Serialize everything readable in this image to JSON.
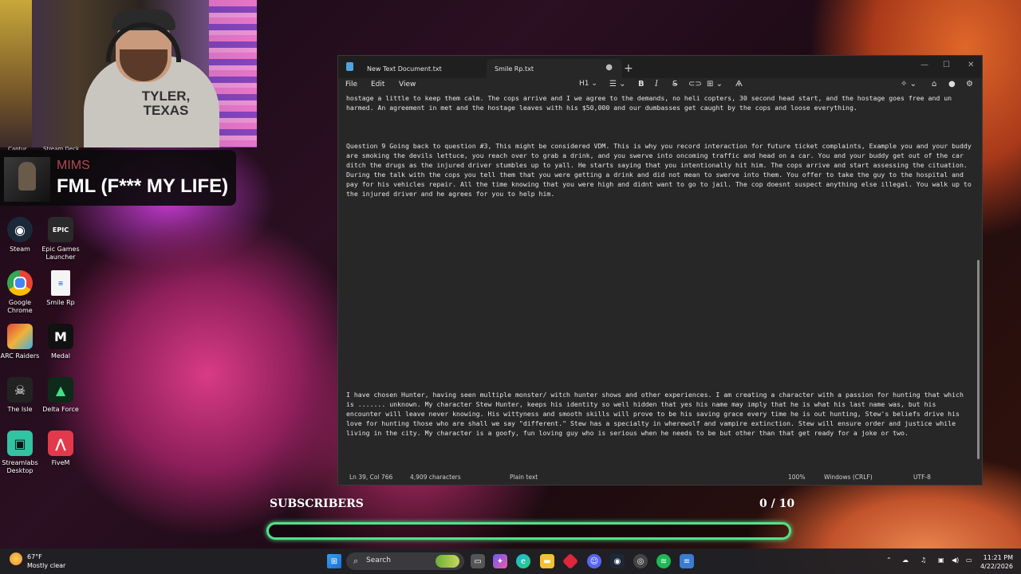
{
  "webcam": {
    "shirt_text": "TYLER, TEXAS",
    "captions": [
      "Captur",
      "Stream Deck"
    ]
  },
  "now_playing": {
    "artist": "MIMS",
    "title": "FML (F*** MY LIFE)"
  },
  "desktop_icons": [
    {
      "label": "Steam",
      "icon": "steam-icon",
      "color": "#1b2838"
    },
    {
      "label": "Epic Games Launcher",
      "icon": "epic-games-icon",
      "color": "#2a2a2a"
    },
    {
      "label": "Google Chrome",
      "icon": "chrome-icon",
      "color": "#ffffff"
    },
    {
      "label": "Smile Rp",
      "icon": "text-file-icon",
      "color": "#ffffff"
    },
    {
      "label": "ARC Raiders",
      "icon": "arc-raiders-icon",
      "color": "#1a1a1a"
    },
    {
      "label": "Medal",
      "icon": "medal-icon",
      "color": "#111111"
    },
    {
      "label": "The Isle",
      "icon": "the-isle-icon",
      "color": "#222222"
    },
    {
      "label": "Delta Force",
      "icon": "delta-force-icon",
      "color": "#0d2a1a"
    },
    {
      "label": "Streamlabs Desktop",
      "icon": "streamlabs-icon",
      "color": "#31c3a2"
    },
    {
      "label": "FiveM",
      "icon": "fivem-icon",
      "color": "#e23a4a"
    }
  ],
  "notepad": {
    "tabs": [
      {
        "label": "New Text Document.txt",
        "active": false
      },
      {
        "label": "Smile Rp.txt",
        "active": true
      }
    ],
    "menus": [
      "File",
      "Edit",
      "View"
    ],
    "heading_select": "H1",
    "paragraphs": {
      "p1": "hostage a little to keep them calm. The cops arrive and I we agree to the demands, no heli copters, 30 second head start, and the hostage goes free and un harmed. An agreement in met and the hostage leaves with his $50,000 and our dumbasses get caught by the cops and loose everything.",
      "p2": "Question 9 Going back to question #3, This might be considered VDM. This is why you record interaction for future ticket complaints, Example you and your buddy are smoking the devils lettuce, you reach over to grab a drink, and you swerve into oncoming traffic and head on a car. You and your buddy get out of the car ditch the drugs as the injured driver stumbles up to yall. He starts saying that you intentionally hit him. The cops arrive and start assessing the cituation. During the talk with the cops you tell them that you were getting a drink and did not mean to swerve into them. You offer to take the guy to the hospital and pay for his vehicles repair. All the time knowing that you were high and didnt want to go to jail. The cop doesnt suspect anything else illegal. You walk up to the injured driver and he agrees for you to help him.",
      "p3": "I have chosen Hunter, having seen multiple monster/ witch hunter shows and other experiences. I am creating a character with a passion for hunting that which is ....... unknown. My character Stew Hunter, keeps his identity so well hidden that yes his name may imply that he is what his last name was, but his encounter will leave never knowing. His wittyness and smooth skills will prove to be his saving grace every time he is out hunting, Stew's beliefs drive his love for hunting those who are shall we say \"different.\" Stew has a specialty in wherewolf and vampire extinction. Stew will ensure order and justice while living in the city. My character is a goofy, fun loving guy who is serious when he needs to be but other than that get ready for a joke or two."
    },
    "status": {
      "position": "Ln 39, Col 766",
      "chars": "4,909 characters",
      "format": "Plain text",
      "zoom": "100%",
      "line_ending": "Windows (CRLF)",
      "encoding": "UTF-8"
    }
  },
  "subscribers": {
    "label": "SUBSCRIBERS",
    "count": "0 / 10",
    "progress": 0,
    "bar_color": "#53e08a"
  },
  "taskbar": {
    "weather_temp": "67°F",
    "weather_desc": "Mostly clear",
    "search_placeholder": "Search",
    "time": "11:21 PM",
    "date": "4/22/2026"
  }
}
